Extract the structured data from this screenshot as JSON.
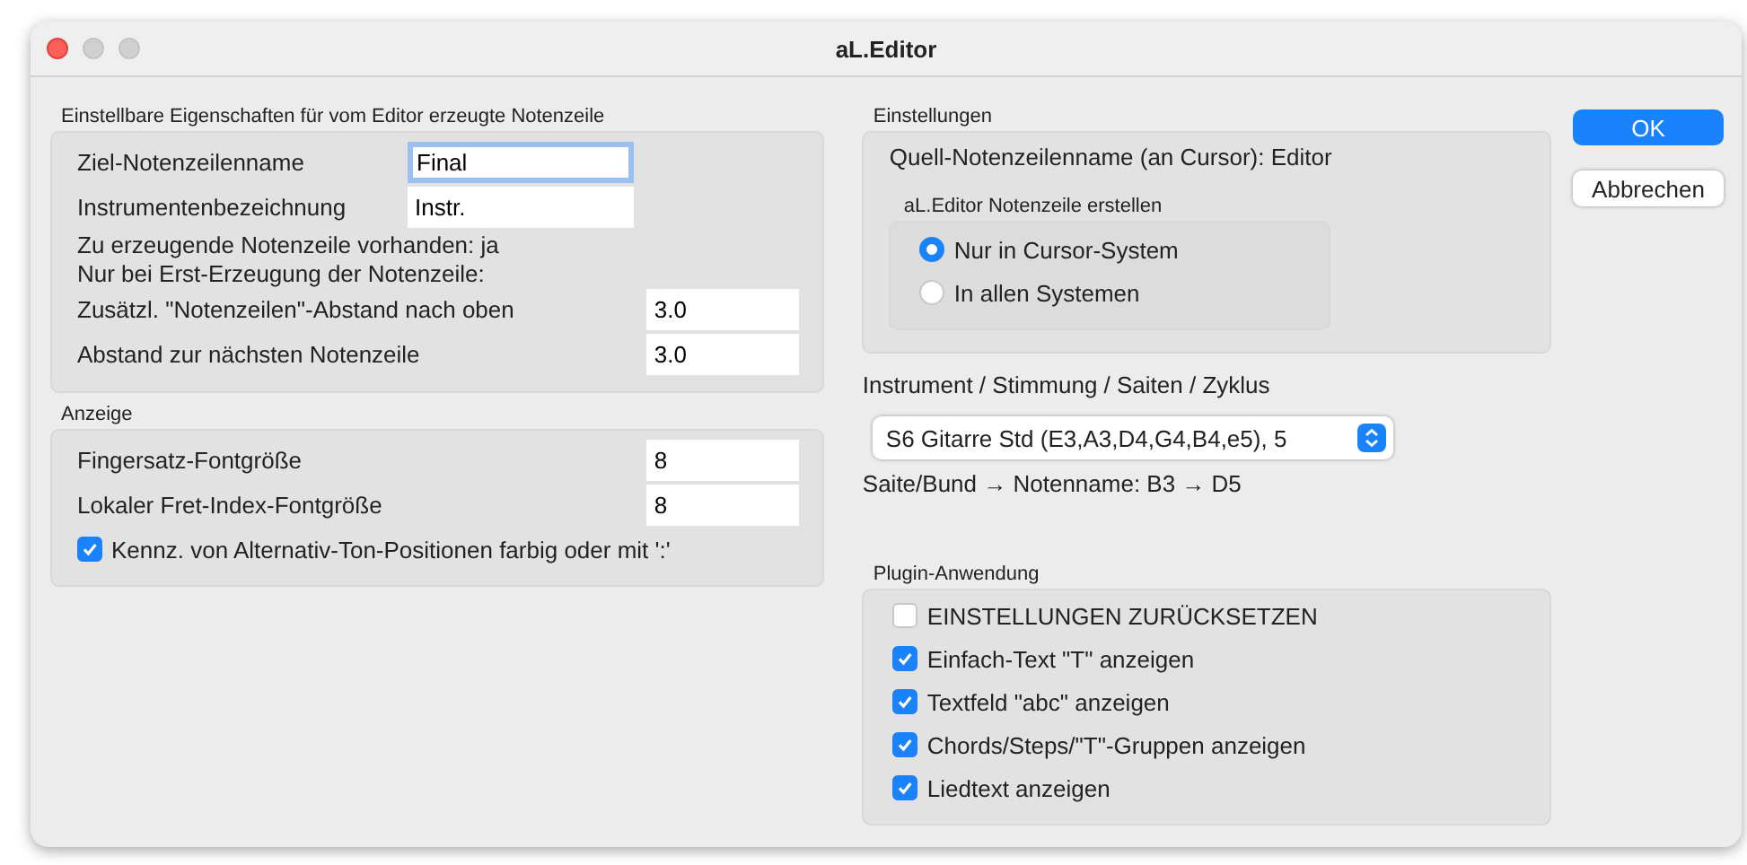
{
  "window": {
    "title": "aL.Editor"
  },
  "left_sections": [
    {
      "title": "Einstellbare Eigenschaften für vom Editor erzeugte Notenzeile",
      "rows": [
        {
          "kind": "name_field",
          "label": "Ziel-Notenzeilenname",
          "value": "Final",
          "focused": true
        },
        {
          "kind": "name_field",
          "label": "Instrumentenbezeichnung",
          "value": "Instr.",
          "focused": false
        },
        {
          "kind": "text",
          "label": "Zu erzeugende Notenzeile vorhanden: ja"
        },
        {
          "kind": "text",
          "label": "Nur bei Erst-Erzeugung der Notenzeile:"
        },
        {
          "kind": "number_field",
          "label": "Zusätzl. \"Notenzeilen\"-Abstand nach oben",
          "value": "3.0",
          "focused": false
        },
        {
          "kind": "number_field",
          "label": "Abstand zur nächsten Notenzeile",
          "value": "3.0",
          "focused": false
        }
      ]
    },
    {
      "title": "Anzeige",
      "rows": [
        {
          "kind": "number_field",
          "label": "Fingersatz-Fontgröße",
          "value": "8",
          "focused": false
        },
        {
          "kind": "number_field",
          "label": "Lokaler Fret-Index-Fontgröße",
          "value": "8",
          "focused": false
        },
        {
          "kind": "checkbox",
          "label": "Kennz. von Alternativ-Ton-Positionen farbig oder mit ':'",
          "checked": true
        }
      ]
    }
  ],
  "settings": {
    "title": "Einstellungen",
    "source_line": "Quell-Notenzeilenname (an Cursor): Editor",
    "radio_group": {
      "title": "aL.Editor Notenzeile erstellen",
      "options": [
        {
          "label": "Nur in Cursor-System",
          "selected": true
        },
        {
          "label": "In allen Systemen",
          "selected": false
        }
      ]
    }
  },
  "instrument": {
    "label": "Instrument / Stimmung / Saiten / Zyklus",
    "select": {
      "value": "S6 Gitarre Std (E3,A3,D4,G4,B4,e5), 5"
    },
    "mapping": "Saite/Bund → Notenname: B3 → D5"
  },
  "plugin": {
    "title": "Plugin-Anwendung",
    "checkboxes": [
      {
        "label": "EINSTELLUNGEN ZURÜCKSETZEN",
        "checked": false
      },
      {
        "label": "Einfach-Text \"T\" anzeigen",
        "checked": true
      },
      {
        "label": "Textfeld \"abc\" anzeigen",
        "checked": true
      },
      {
        "label": "Chords/Steps/\"T\"-Gruppen anzeigen",
        "checked": true
      },
      {
        "label": "Liedtext anzeigen",
        "checked": true
      }
    ]
  },
  "buttons": [
    {
      "label": "OK",
      "kind": "default"
    },
    {
      "label": "Abbrechen",
      "kind": "normal"
    }
  ]
}
